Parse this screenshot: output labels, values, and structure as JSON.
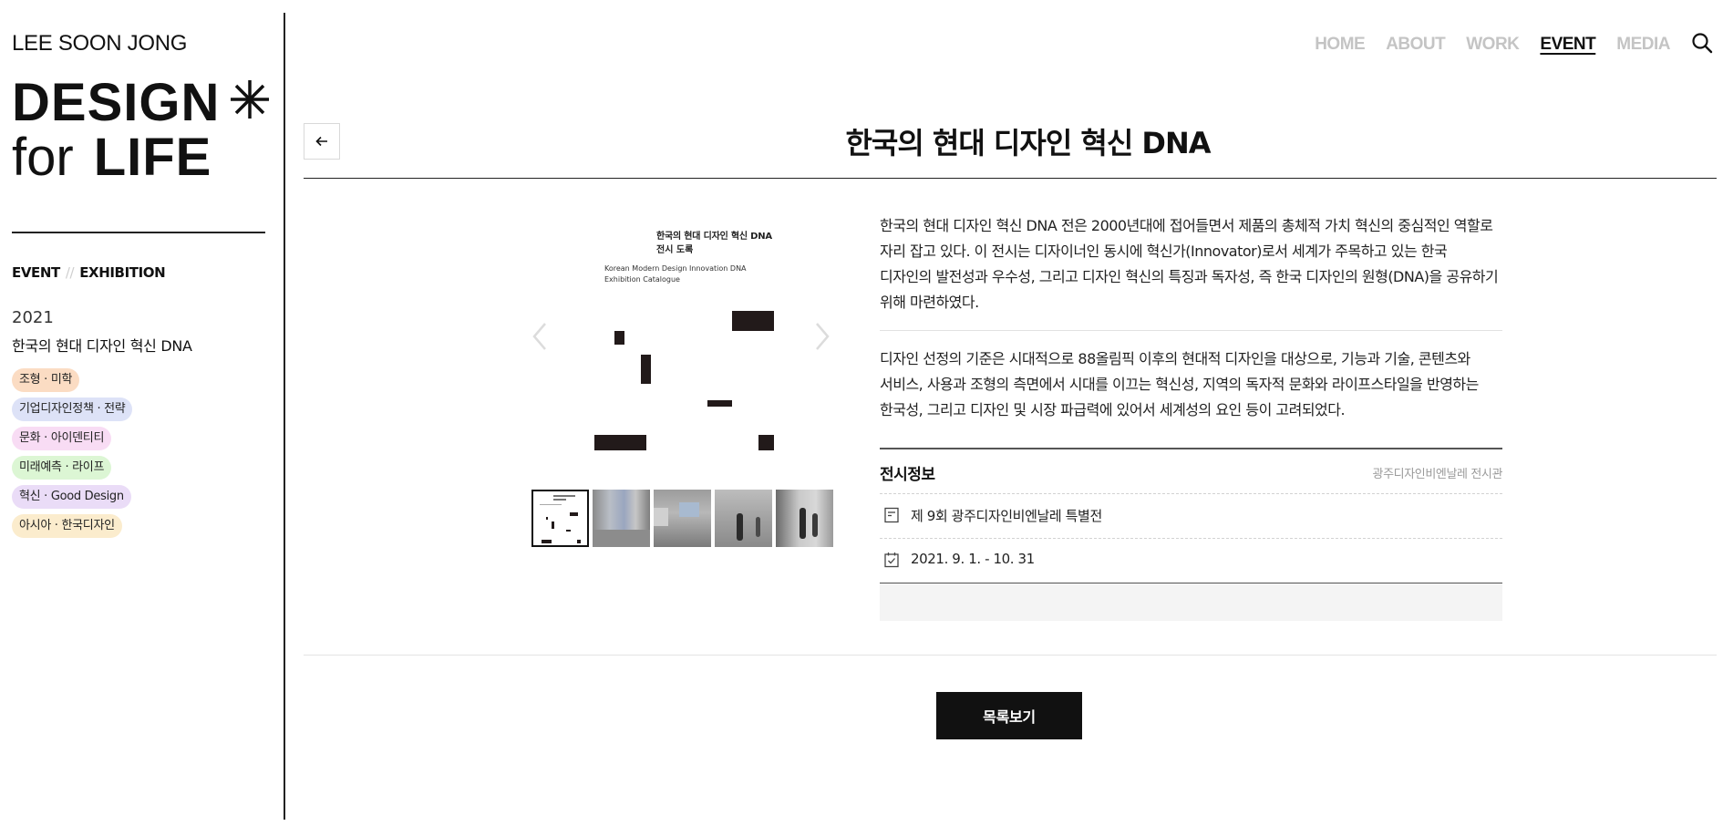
{
  "site": {
    "brand": "LEE SOON JONG",
    "logo_line1": "DESIGN",
    "logo_line2_a": "for",
    "logo_line2_b": "LIFE"
  },
  "nav": {
    "items": [
      {
        "label": "HOME",
        "active": false
      },
      {
        "label": "ABOUT",
        "active": false
      },
      {
        "label": "WORK",
        "active": false
      },
      {
        "label": "EVENT",
        "active": true
      },
      {
        "label": "MEDIA",
        "active": false
      }
    ],
    "search_icon": "search-icon"
  },
  "sidebar": {
    "breadcrumb": [
      "EVENT",
      "EXHIBITION"
    ],
    "breadcrumb_sep": "//",
    "year": "2021",
    "title": "한국의 현대 디자인 혁신 DNA",
    "tags": [
      {
        "label": "조형 · 미학",
        "color": "#fbdcc3"
      },
      {
        "label": "기업디자인정책 · 전략",
        "color": "#dde2f7"
      },
      {
        "label": "문화 · 아이덴티티",
        "color": "#f8dcf4"
      },
      {
        "label": "미래예측 · 라이프",
        "color": "#dcf6d4"
      },
      {
        "label": "혁신 · Good Design",
        "color": "#eadcf7"
      },
      {
        "label": "아시아 · 한국디자인",
        "color": "#fbeccd"
      }
    ]
  },
  "page": {
    "title": "한국의 현대 디자인 혁신 DNA",
    "back_icon": "arrow-left-icon"
  },
  "gallery": {
    "cover_title_1": "한국의 현대 디자인 혁신 DNA",
    "cover_title_2": "전시 도록",
    "cover_sub_1": "Korean Modern Design Innovation DNA",
    "cover_sub_2": "Exhibition Catalogue",
    "thumb_count": 5
  },
  "description": {
    "p1": "한국의 현대 디자인 혁신 DNA 전은 2000년대에 접어들면서 제품의 총체적 가치 혁신의 중심적인 역할로 자리 잡고 있다. 이 전시는 디자이너인 동시에 혁신가(Innovator)로서 세계가 주목하고 있는 한국 디자인의 발전성과 우수성, 그리고 디자인 혁신의 특징과 독자성, 즉 한국 디자인의 원형(DNA)을 공유하기 위해 마련하였다.",
    "p2": "디자인 선정의 기준은 시대적으로 88올림픽 이후의 현대적 디자인을 대상으로, 기능과 기술, 콘텐츠와 서비스, 사용과 조형의 측면에서 시대를 이끄는 혁신성, 지역의 독자적 문화와 라이프스타일을 반영하는 한국성, 그리고 디자인 및 시장 파급력에 있어서 세계성의 요인 등이 고려되었다."
  },
  "info": {
    "heading": "전시정보",
    "venue": "광주디자인비엔날레 전시관",
    "event": "제 9회 광주디자인비엔날레 특별전",
    "period": "2021. 9. 1. - 10. 31"
  },
  "actions": {
    "list_label": "목록보기"
  }
}
